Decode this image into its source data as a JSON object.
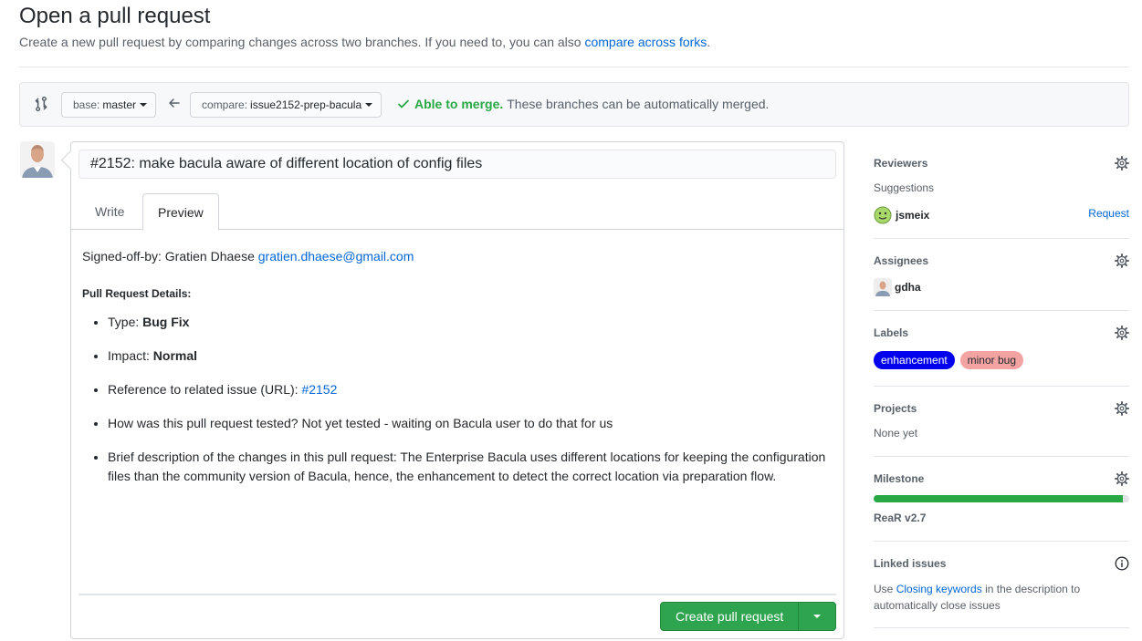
{
  "page": {
    "title": "Open a pull request",
    "subtitle_text": "Create a new pull request by comparing changes across two branches. If you need to, you can also",
    "subtitle_link": "compare across forks",
    "subtitle_end": "."
  },
  "range": {
    "base_label": "base:",
    "base_value": "master",
    "compare_label": "compare:",
    "compare_value": "issue2152-prep-bacula",
    "merge_status": "Able to merge.",
    "merge_detail": "These branches can be automatically merged."
  },
  "composer": {
    "title_value": "#2152: make bacula aware of different location of config files",
    "tabs": [
      {
        "label": "Write"
      },
      {
        "label": "Preview"
      }
    ],
    "preview": {
      "signoff_text": "Signed-off-by: Gratien Dhaese",
      "signoff_email": "gratien.dhaese@gmail.com",
      "heading": "Pull Request Details:",
      "items": [
        {
          "prefix": "Type: ",
          "bold": "Bug Fix"
        },
        {
          "prefix": "Impact: ",
          "bold": "Normal"
        },
        {
          "prefix": "Reference to related issue (URL): ",
          "link": "#2152"
        },
        {
          "text": "How was this pull request tested? Not yet tested - waiting on Bacula user to do that for us"
        },
        {
          "text": "Brief description of the changes in this pull request: The Enterprise Bacula uses different locations for keeping the configuration files than the community version of Bacula, hence, the enhancement to detect the correct location via preparation flow."
        }
      ]
    },
    "create_button": "Create pull request"
  },
  "sidebar": {
    "reviewers": {
      "title": "Reviewers",
      "suggestions_label": "Suggestions",
      "user": "jsmeix",
      "request_link": "Request"
    },
    "assignees": {
      "title": "Assignees",
      "user": "gdha"
    },
    "labels": {
      "title": "Labels",
      "items": [
        {
          "name": "enhancement",
          "bg": "#0000ee",
          "fg": "#ffffff"
        },
        {
          "name": "minor bug",
          "bg": "#f4a3a3",
          "fg": "#24292e"
        }
      ]
    },
    "projects": {
      "title": "Projects",
      "value": "None yet"
    },
    "milestone": {
      "title": "Milestone",
      "name": "ReaR v2.7",
      "progress_percent": 97.5
    },
    "linked_issues": {
      "title": "Linked issues",
      "text_before": "Use",
      "link": "Closing keywords",
      "text_after": "in the description to automatically close issues"
    }
  },
  "colors": {
    "accent_link": "#0366d6",
    "success_green": "#2ea44f"
  }
}
